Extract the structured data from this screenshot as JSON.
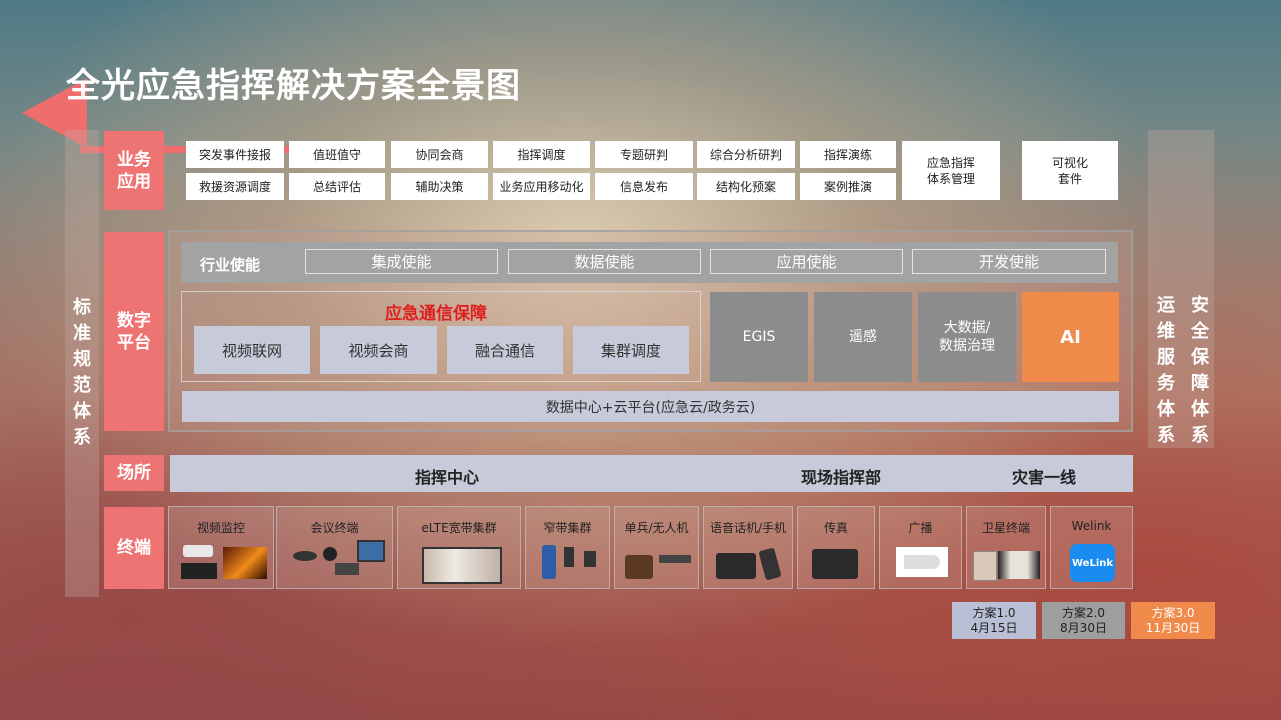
{
  "title": "全光应急指挥解决方案全景图",
  "left_panel": "标准规范体系",
  "right_panels": [
    "运维服务体系",
    "安全保障体系"
  ],
  "layers": {
    "business": "业务应用",
    "digital": "数字平台",
    "site": "场所",
    "terminal": "终端"
  },
  "business_apps": {
    "row1": [
      "突发事件接报",
      "值班值守",
      "协同会商",
      "指挥调度",
      "专题研判",
      "综合分析研判",
      "指挥演练"
    ],
    "row2": [
      "救援资源调度",
      "总结评估",
      "辅助决策",
      "业务应用移动化",
      "信息发布",
      "结构化预案",
      "案例推演"
    ],
    "tall_box": "应急指挥体系管理",
    "tall_box_lines": [
      "应急指挥",
      "体系管理"
    ],
    "visual_kit_lines": [
      "可视化",
      "套件"
    ]
  },
  "enablement": {
    "title": "行业使能",
    "items": [
      "集成使能",
      "数据使能",
      "应用使能",
      "开发使能"
    ]
  },
  "emergency_comm": {
    "title": "应急通信保障",
    "items": [
      "视频联网",
      "视频会商",
      "融合通信",
      "集群调度"
    ]
  },
  "platform_boxes": {
    "egis": "EGIS",
    "remote": "遥感",
    "bigdata_lines": [
      "大数据/",
      "数据治理"
    ],
    "ai": "AI"
  },
  "cloud": "数据中心+云平台(应急云/政务云)",
  "sites": [
    "指挥中心",
    "现场指挥部",
    "灾害一线"
  ],
  "terminals": [
    "视频监控",
    "会议终端",
    "eLTE宽带集群",
    "窄带集群",
    "单兵/无人机",
    "语音话机/手机",
    "传真",
    "广播",
    "卫星终端",
    "Welink"
  ],
  "welink_logo": "WeLink",
  "versions": [
    {
      "name": "方案1.0",
      "date": "4月15日",
      "color": "#b9c0d6"
    },
    {
      "name": "方案2.0",
      "date": "8月30日",
      "color": "#9e9e9e"
    },
    {
      "name": "方案3.0",
      "date": "11月30日",
      "color": "#ef8a4a"
    }
  ]
}
